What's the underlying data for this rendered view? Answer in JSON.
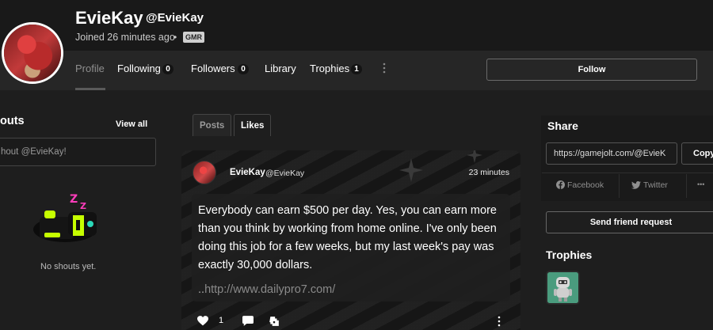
{
  "profile": {
    "name": "EvieKay",
    "handle": "@EvieKay",
    "joined": "Joined 26 minutes ago",
    "dot": "•",
    "badge": "GMR"
  },
  "nav": {
    "profile": "Profile",
    "following": "Following",
    "following_count": "0",
    "followers": "Followers",
    "followers_count": "0",
    "library": "Library",
    "trophies": "Trophies",
    "trophies_count": "1",
    "follow_label": "Follow"
  },
  "shouts": {
    "title": "outs",
    "view_all": "View all",
    "placeholder": "hout @EvieKay!",
    "empty": "No shouts yet."
  },
  "tabs": {
    "posts": "Posts",
    "likes": "Likes"
  },
  "post": {
    "name": "EvieKay",
    "handle": "@EvieKay",
    "time": "23 minutes",
    "text": "Everybody can earn $500 per day. Yes, you can earn more than you think by working from home online. I've only been doing this job for a few weeks, but my last week's pay was exactly 30,000 dollars.",
    "link_prefix": "..",
    "link": "http://www.dailypro7.com/",
    "likes": "1"
  },
  "share": {
    "title": "Share",
    "url": "https://gamejolt.com/@EvieK",
    "copy": "Copy",
    "facebook": "Facebook",
    "twitter": "Twitter",
    "more": "•••",
    "friend_request": "Send friend request",
    "trophies_title": "Trophies"
  },
  "colors": {
    "background": "#1e1e1e",
    "header": "#191919",
    "nav": "#262626",
    "trophy": "#4a9c7e",
    "shout_accent_pink": "#ff3dbb",
    "shout_accent_green": "#c6ff00"
  },
  "icons": {
    "heart": "heart-icon",
    "comment": "comment-icon",
    "game": "gamepad-icon",
    "more": "more-vertical-icon",
    "facebook": "facebook-icon",
    "twitter": "twitter-icon"
  }
}
